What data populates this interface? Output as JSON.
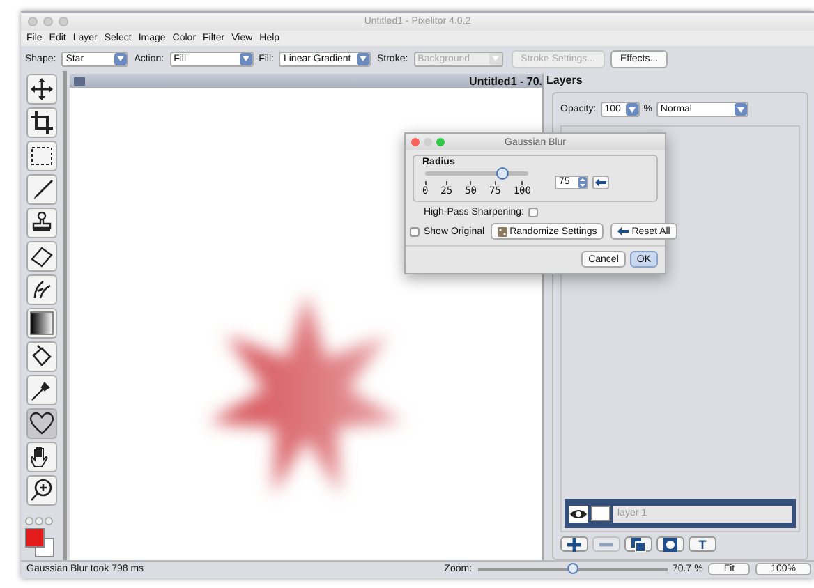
{
  "window": {
    "title": "Untitled1 - Pixelitor 4.0.2"
  },
  "menu": [
    "File",
    "Edit",
    "Layer",
    "Select",
    "Image",
    "Color",
    "Filter",
    "View",
    "Help"
  ],
  "toolbar": {
    "shape": {
      "label": "Shape:",
      "value": "Star"
    },
    "action": {
      "label": "Action:",
      "value": "Fill"
    },
    "fill": {
      "label": "Fill:",
      "value": "Linear Gradient"
    },
    "stroke": {
      "label": "Stroke:",
      "value": "Background",
      "disabled": true
    },
    "stroke_settings": {
      "label": "Stroke Settings...",
      "disabled": true
    },
    "effects": {
      "label": "Effects...",
      "disabled": false
    }
  },
  "tools": [
    {
      "selected": false
    },
    {
      "selected": false
    },
    {
      "selected": false
    },
    {
      "selected": false
    },
    {
      "selected": false
    },
    {
      "selected": false
    },
    {
      "selected": false
    },
    {
      "selected": false
    },
    {
      "selected": false
    },
    {
      "selected": false
    },
    {
      "selected": true
    },
    {
      "selected": false
    },
    {
      "selected": false
    }
  ],
  "canvas": {
    "title": "Untitled1 - 70."
  },
  "dialog": {
    "title": "Gaussian Blur",
    "radius": {
      "label": "Radius",
      "level": 0.75,
      "ticks": [
        "0",
        "25",
        "50",
        "75",
        "100"
      ],
      "value": "75"
    },
    "high_pass": {
      "label": "High-Pass Sharpening:",
      "checked": false
    },
    "show_original": {
      "label": "Show Original",
      "checked": false
    },
    "randomize": "Randomize Settings",
    "reset": "Reset All",
    "cancel": "Cancel",
    "ok": "OK"
  },
  "layers": {
    "title": "Layers",
    "opacity_label": "Opacity:",
    "opacity": "100",
    "percent": "%",
    "blend": "Normal",
    "items": [
      {
        "name": "layer 1",
        "visible": true,
        "selected": true
      }
    ],
    "buttons": [
      {
        "kind": "add",
        "disabled": false
      },
      {
        "kind": "delete",
        "disabled": true
      },
      {
        "kind": "duplicate",
        "disabled": false
      },
      {
        "kind": "mask",
        "disabled": false
      },
      {
        "kind": "text",
        "label": "T",
        "disabled": false
      }
    ]
  },
  "status": {
    "message": "Gaussian Blur took 798 ms",
    "zoom_label": "Zoom:",
    "zoom": {
      "level": 0.5
    },
    "zoom_value": "70.7 %",
    "fit": "Fit",
    "actual": "100%"
  }
}
